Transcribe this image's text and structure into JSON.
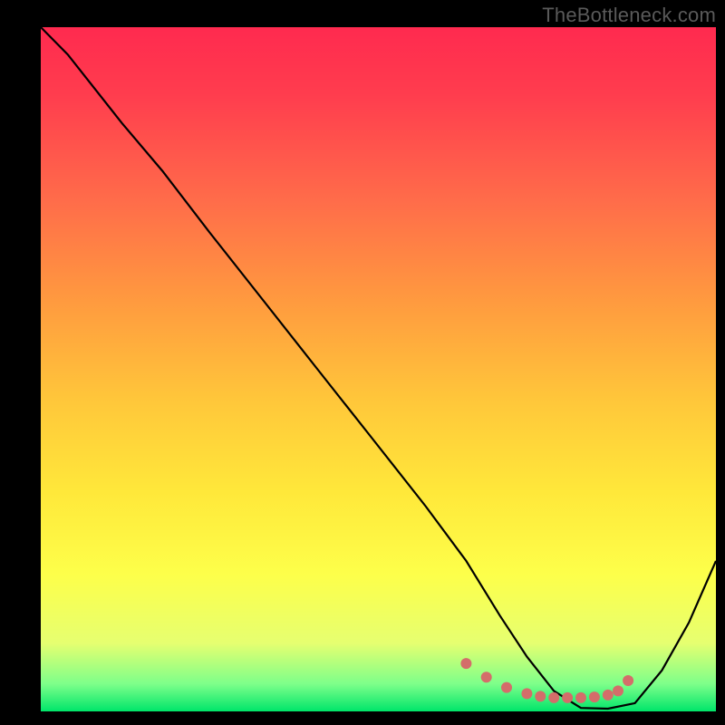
{
  "watermark": "TheBottleneck.com",
  "chart_data": {
    "type": "line",
    "title": "",
    "xlabel": "",
    "ylabel": "",
    "ylim": [
      0,
      100
    ],
    "series": [
      {
        "name": "curve",
        "x": [
          0,
          4,
          8,
          12,
          18,
          25,
          33,
          41,
          49,
          57,
          63,
          68,
          72,
          76,
          80,
          84,
          88,
          92,
          96,
          100
        ],
        "y": [
          100,
          96,
          91,
          86,
          79,
          70,
          60,
          50,
          40,
          30,
          22,
          14,
          8,
          3,
          0.5,
          0.4,
          1.2,
          6,
          13,
          22
        ]
      }
    ],
    "markers": {
      "name": "dots",
      "color": "#d46d6a",
      "points": [
        {
          "x": 63,
          "y": 7.0
        },
        {
          "x": 66,
          "y": 5.0
        },
        {
          "x": 69,
          "y": 3.5
        },
        {
          "x": 72,
          "y": 2.6
        },
        {
          "x": 74,
          "y": 2.2
        },
        {
          "x": 76,
          "y": 2.0
        },
        {
          "x": 78,
          "y": 2.0
        },
        {
          "x": 80,
          "y": 2.0
        },
        {
          "x": 82,
          "y": 2.1
        },
        {
          "x": 84,
          "y": 2.4
        },
        {
          "x": 85.5,
          "y": 3.0
        },
        {
          "x": 87,
          "y": 4.5
        }
      ]
    }
  },
  "colors": {
    "curve_stroke": "#000000",
    "marker_fill": "#d46d6a"
  }
}
